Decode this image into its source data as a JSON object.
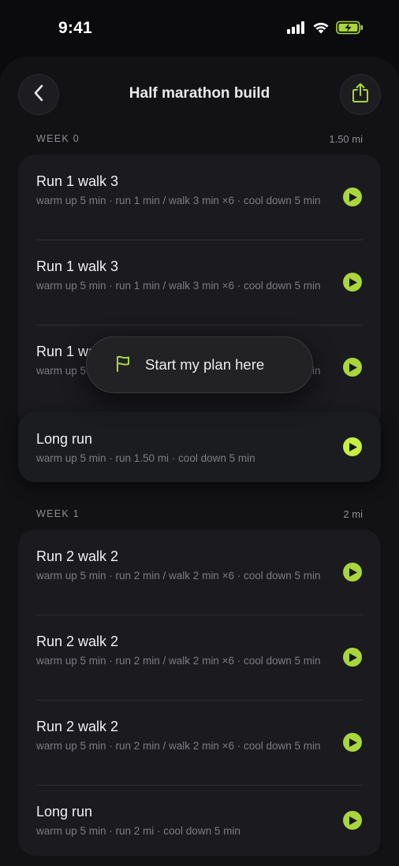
{
  "status_bar": {
    "time": "9:41",
    "icons": [
      "cellular-signal-icon",
      "wifi-icon",
      "battery-charging-icon"
    ]
  },
  "header": {
    "title": "Half marathon build",
    "back_icon": "chevron-left-icon",
    "share_icon": "share-icon"
  },
  "weeks": [
    {
      "label": "WEEK 0",
      "distance": "1.50 mi",
      "workouts": [
        {
          "title": "Run 1 walk 3",
          "subtitle": "warm up 5 min · run 1 min / walk 3 min ×6 · cool down 5 min"
        },
        {
          "title": "Run 1 walk 3",
          "subtitle": "warm up 5 min · run 1 min / walk 3 min ×6 · cool down 5 min"
        },
        {
          "title": "Run 1 walk 3",
          "subtitle": "warm up 5 min · run 1 min / walk 3 min ×6 · cool down 5 min"
        },
        {
          "title": "Long run",
          "subtitle": "warm up 5 min · run 1.50 mi · cool down 5 min"
        }
      ]
    },
    {
      "label": "WEEK 1",
      "distance": "2 mi",
      "workouts": [
        {
          "title": "Run 2 walk 2",
          "subtitle": "warm up 5 min · run 2 min / walk 2 min ×6 · cool down 5 min"
        },
        {
          "title": "Run 2 walk 2",
          "subtitle": "warm up 5 min · run 2 min / walk 2 min ×6 · cool down 5 min"
        },
        {
          "title": "Run 2 walk 2",
          "subtitle": "warm up 5 min · run 2 min / walk 2 min ×6 · cool down 5 min"
        },
        {
          "title": "Long run",
          "subtitle": "warm up 5 min · run 2 mi · cool down 5 min"
        }
      ]
    }
  ],
  "tooltip": {
    "label": "Start my plan here",
    "icon": "flag-icon"
  },
  "colors": {
    "accent": "#a8d63c",
    "accent_highlight": "#c6ef3f",
    "background": "#121215",
    "card": "#1a1a1f"
  }
}
